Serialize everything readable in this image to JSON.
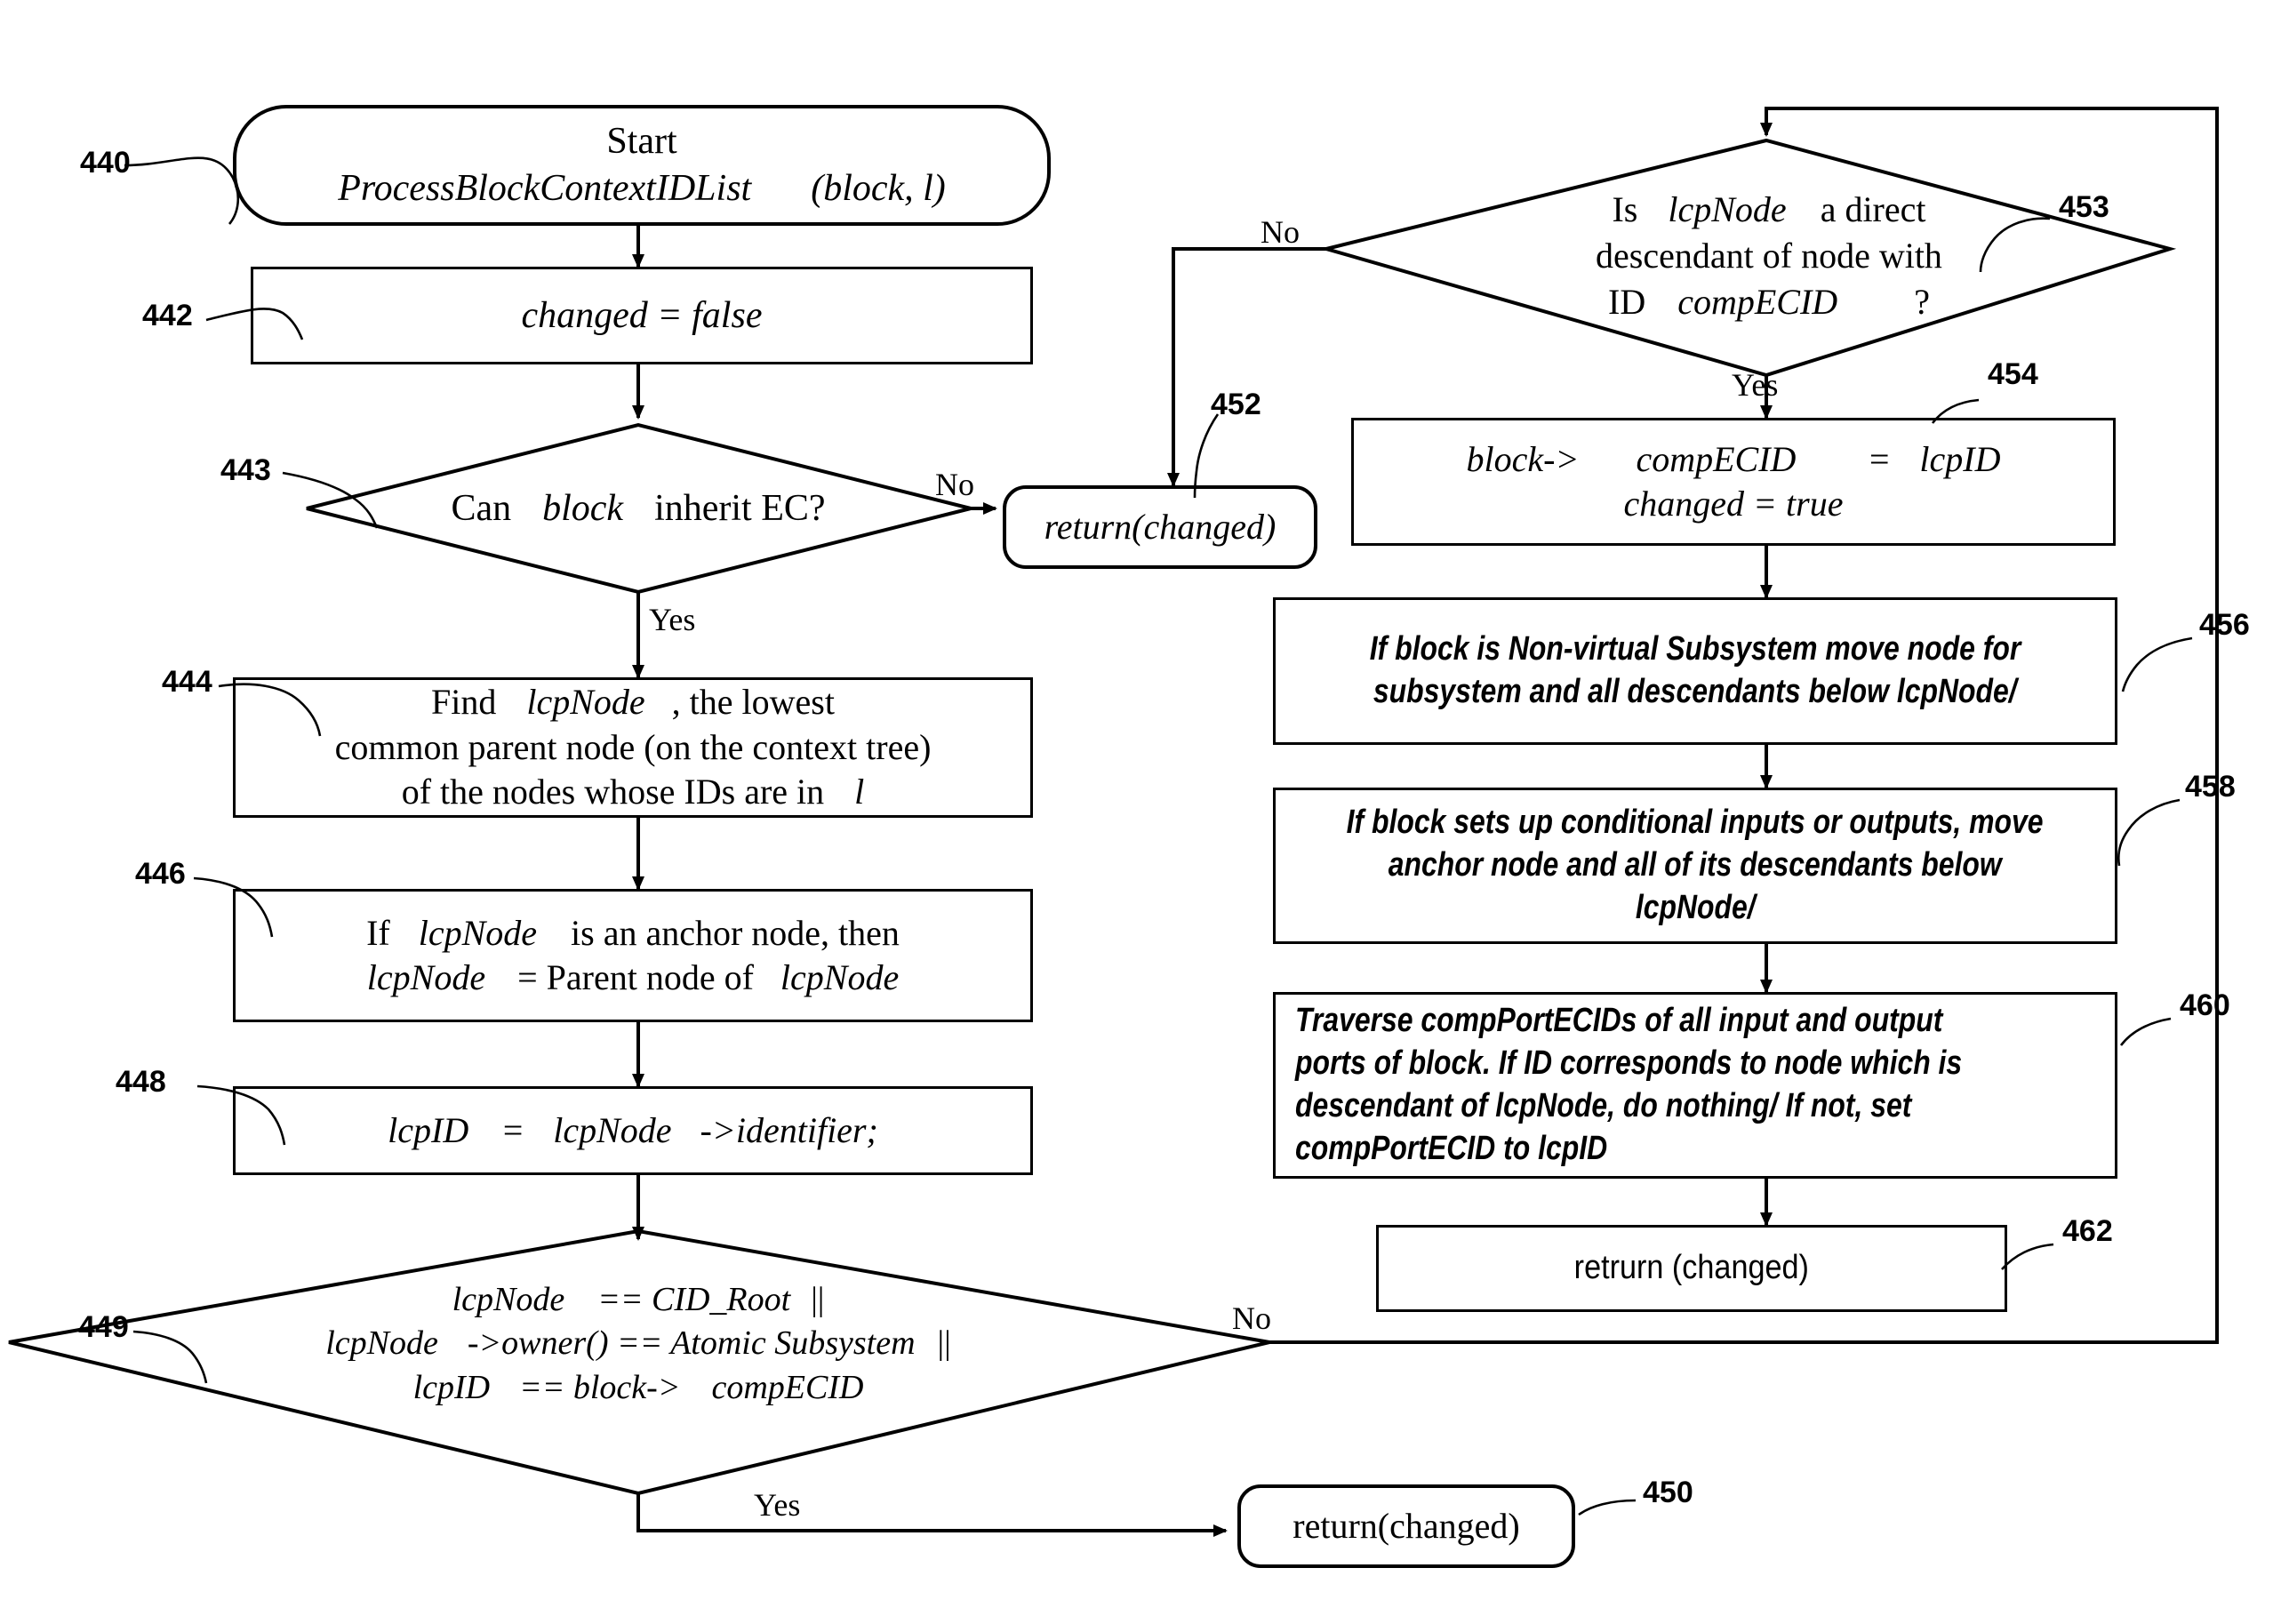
{
  "figure": {
    "type": "flowchart",
    "title": "ProcessBlockContextIDList flowchart"
  },
  "nodes": {
    "start": {
      "ref": "440",
      "shape": "terminator",
      "line1": "Start",
      "line2": "ProcessBlockContextIDList",
      "line3": "(block, l)"
    },
    "changed_false": {
      "ref": "442",
      "shape": "process",
      "text": "changed = false"
    },
    "can_inherit": {
      "ref": "443",
      "shape": "decision",
      "text_plain": "Can",
      "text_italic": "block",
      "text_tail": "inherit EC?",
      "yes_label": "Yes",
      "no_label": "No"
    },
    "return_452": {
      "ref": "452",
      "shape": "terminator",
      "text": "return(changed)"
    },
    "find_lcpnode": {
      "ref": "444",
      "shape": "process",
      "line1_a": "Find",
      "line1_b": "lcpNode",
      "line1_c": ", the lowest",
      "line2": "common parent node (on the context tree)",
      "line3_a": "of the nodes whose IDs are in",
      "line3_b": "l"
    },
    "anchor_node": {
      "ref": "446",
      "shape": "process",
      "line1_a": "If",
      "line1_b": "lcpNode",
      "line1_c": "is an anchor node, then",
      "line2_a": "lcpNode",
      "line2_b": "=  Parent node of",
      "line2_c": "lcpNode"
    },
    "lcpid_assign": {
      "ref": "448",
      "shape": "process",
      "text_a": "lcpID",
      "text_b": "=",
      "text_c": "lcpNode",
      "text_d": "->identifier;"
    },
    "root_check": {
      "ref": "449",
      "shape": "decision",
      "line1_a": "lcpNode",
      "line1_b": "== CID_Root",
      "line1_c": "||",
      "line2_a": "lcpNode",
      "line2_b": "->owner() == Atomic Subsystem",
      "line2_c": "||",
      "line3_a": "lcpID",
      "line3_b": "== block->",
      "line3_c": "compECID",
      "yes_label": "Yes",
      "no_label": "No"
    },
    "return_450": {
      "ref": "450",
      "shape": "terminator",
      "text": "return(changed)"
    },
    "is_direct_descendant": {
      "ref": "453",
      "shape": "decision",
      "line1_a": "Is",
      "line1_b": "lcpNode",
      "line1_c": "a direct",
      "line2": "descendant of node with",
      "line3_a": "ID",
      "line3_b": "compECID",
      "line3_c": "?",
      "yes_label": "Yes",
      "no_label": "No"
    },
    "assign_compecid": {
      "ref": "454",
      "shape": "process",
      "line1_a": "block->",
      "line1_b": "compECID",
      "line1_c": "=",
      "line1_d": "lcpID",
      "line2": "changed = true"
    },
    "move_subsystem": {
      "ref": "456",
      "shape": "process",
      "line1": "If block is Non-virtual Subsystem move node for",
      "line2": "subsystem and all descendants below lcpNode/"
    },
    "move_anchor": {
      "ref": "458",
      "shape": "process",
      "line1": "If block sets up conditional  inputs or outputs, move",
      "line2": "anchor node and all of its descendants below",
      "line3": "lcpNode/"
    },
    "traverse_ports": {
      "ref": "460",
      "shape": "process",
      "line1": "Traverse compPortECIDs of all input and output",
      "line2": "ports of block.  If ID corresponds to node which  is",
      "line3": "descendant of lcpNode, do nothing/  If not, set",
      "line4": "compPortECID to lcpID"
    },
    "return_462": {
      "ref": "462",
      "shape": "process",
      "text": "retrurn (changed)"
    }
  },
  "colors": {
    "stroke": "#000000",
    "background": "#ffffff"
  }
}
